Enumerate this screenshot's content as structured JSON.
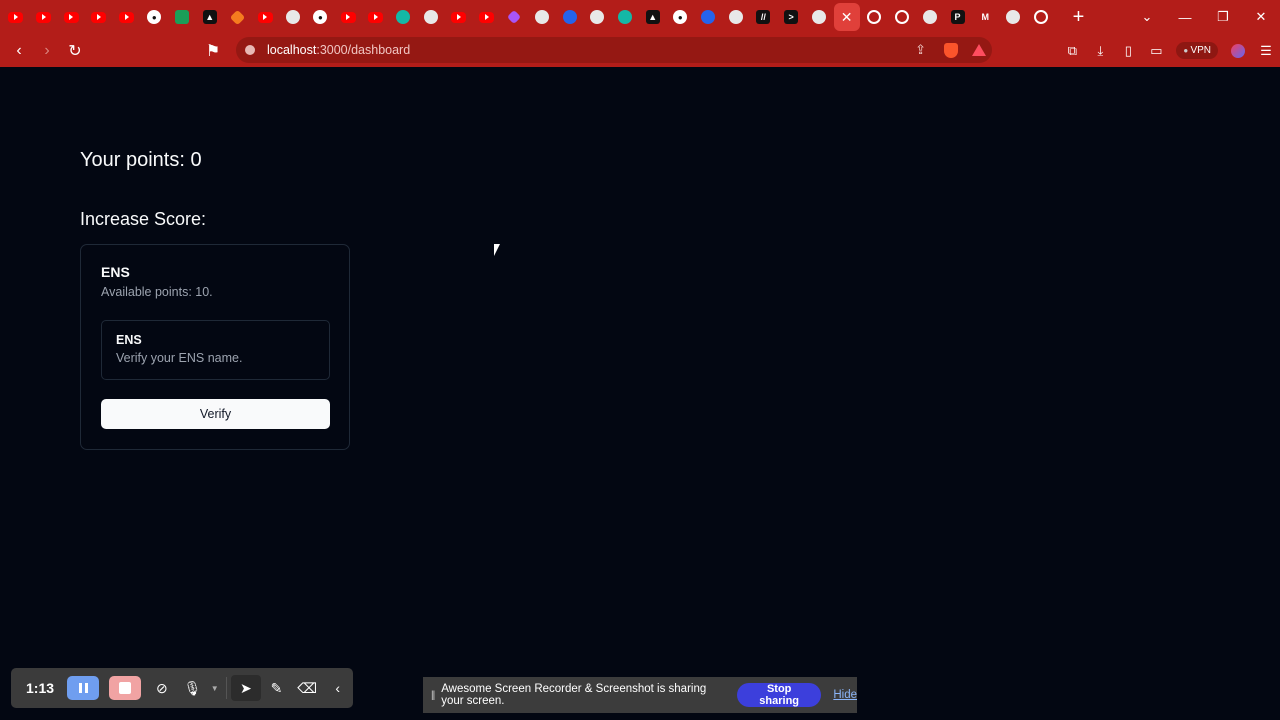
{
  "browser": {
    "tabs": [
      {
        "icon": "youtube-icon"
      },
      {
        "icon": "youtube-icon"
      },
      {
        "icon": "youtube-icon"
      },
      {
        "icon": "youtube-icon"
      },
      {
        "icon": "youtube-icon"
      },
      {
        "icon": "github-icon"
      },
      {
        "icon": "green-app-icon"
      },
      {
        "icon": "triangle-icon"
      },
      {
        "icon": "orange-cube-icon"
      },
      {
        "icon": "youtube-icon"
      },
      {
        "icon": "terminal-icon"
      },
      {
        "icon": "github-icon"
      },
      {
        "icon": "youtube-icon"
      },
      {
        "icon": "youtube-icon"
      },
      {
        "icon": "arrow-app-icon"
      },
      {
        "icon": "circle-app-icon"
      },
      {
        "icon": "youtube-icon"
      },
      {
        "icon": "youtube-icon"
      },
      {
        "icon": "purple-star-icon"
      },
      {
        "icon": "circle-app-icon"
      },
      {
        "icon": "blue-app-icon"
      },
      {
        "icon": "circle-app-icon"
      },
      {
        "icon": "teal-app-icon"
      },
      {
        "icon": "triangle-icon"
      },
      {
        "icon": "github-icon"
      },
      {
        "icon": "blue-app-icon"
      },
      {
        "icon": "openai-icon"
      },
      {
        "icon": "slash-app-icon"
      },
      {
        "icon": "prompt-icon"
      },
      {
        "icon": "circle-app-icon"
      },
      {
        "icon": "close-icon",
        "active": true
      },
      {
        "icon": "ring-icon"
      },
      {
        "icon": "ring-icon"
      },
      {
        "icon": "globe-icon"
      },
      {
        "icon": "p-app-icon"
      },
      {
        "icon": "gmail-icon"
      },
      {
        "icon": "circle-app-icon"
      },
      {
        "icon": "ring-icon"
      }
    ],
    "new_tab": "+",
    "url_host": "localhost",
    "url_path": ":3000/dashboard",
    "vpn_label": "VPN"
  },
  "page": {
    "points_label": "Your points: 0",
    "increase_label": "Increase Score:",
    "card": {
      "title": "ENS",
      "subtitle": "Available points: 10.",
      "task_title": "ENS",
      "task_description": "Verify your ENS name.",
      "button_label": "Verify"
    }
  },
  "recorder": {
    "time": "1:13"
  },
  "sharing": {
    "message": "Awesome Screen Recorder & Screenshot is sharing your screen.",
    "stop_label": "Stop sharing",
    "hide_label": "Hide"
  },
  "colors": {
    "browser_chrome": "#b31d19",
    "page_background": "#030712",
    "stop_button": "#3c3fdc"
  }
}
